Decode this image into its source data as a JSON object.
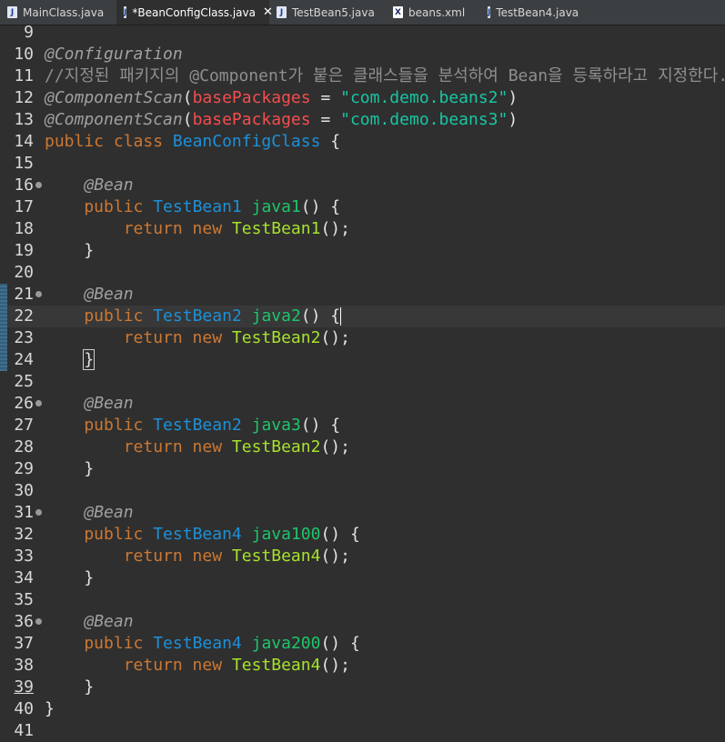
{
  "tabs": [
    {
      "label": "MainClass.java",
      "icon": "java-file-icon",
      "active": false
    },
    {
      "label": "*BeanConfigClass.java",
      "icon": "java-file-icon",
      "active": true,
      "close": "✕"
    },
    {
      "label": "TestBean5.java",
      "icon": "java-file-icon",
      "active": false
    },
    {
      "label": "beans.xml",
      "icon": "xml-file-icon",
      "active": false
    },
    {
      "label": "TestBean4.java",
      "icon": "java-file-icon",
      "active": false
    }
  ],
  "editor": {
    "current_line": 22,
    "lines": [
      {
        "n": "9",
        "tokens": []
      },
      {
        "n": "10",
        "tokens": [
          {
            "t": "@Configuration",
            "c": "ann"
          }
        ]
      },
      {
        "n": "11",
        "tokens": [
          {
            "t": "//지정된 패키지의 @Component가 붙은 클래스들을 분석하여 Bean을 등록하라고 지정한다.",
            "c": "cmt"
          }
        ]
      },
      {
        "n": "12",
        "tokens": [
          {
            "t": "@ComponentScan",
            "c": "ann"
          },
          {
            "t": "(",
            "c": "txt"
          },
          {
            "t": "basePackages",
            "c": "attr"
          },
          {
            "t": " = ",
            "c": "txt"
          },
          {
            "t": "\"com.demo.beans2\"",
            "c": "str"
          },
          {
            "t": ")",
            "c": "txt"
          }
        ]
      },
      {
        "n": "13",
        "tokens": [
          {
            "t": "@ComponentScan",
            "c": "ann"
          },
          {
            "t": "(",
            "c": "txt"
          },
          {
            "t": "basePackages",
            "c": "attr"
          },
          {
            "t": " = ",
            "c": "txt"
          },
          {
            "t": "\"com.demo.beans3\"",
            "c": "str"
          },
          {
            "t": ")",
            "c": "txt"
          }
        ]
      },
      {
        "n": "14",
        "tokens": [
          {
            "t": "public class ",
            "c": "kw"
          },
          {
            "t": "BeanConfigClass",
            "c": "ty"
          },
          {
            "t": " {",
            "c": "txt"
          }
        ]
      },
      {
        "n": "15",
        "tokens": []
      },
      {
        "n": "16",
        "fold": true,
        "tokens": [
          {
            "t": "    ",
            "c": "txt"
          },
          {
            "t": "@Bean",
            "c": "ann"
          }
        ]
      },
      {
        "n": "17",
        "tokens": [
          {
            "t": "    public ",
            "c": "kw"
          },
          {
            "t": "TestBean1",
            "c": "ty"
          },
          {
            "t": " ",
            "c": "txt"
          },
          {
            "t": "java1",
            "c": "mt"
          },
          {
            "t": "() {",
            "c": "txt"
          }
        ]
      },
      {
        "n": "18",
        "tokens": [
          {
            "t": "        return new ",
            "c": "kw"
          },
          {
            "t": "TestBean1",
            "c": "cls"
          },
          {
            "t": "();",
            "c": "txt"
          }
        ]
      },
      {
        "n": "19",
        "tokens": [
          {
            "t": "    }",
            "c": "txt"
          }
        ]
      },
      {
        "n": "20",
        "tokens": []
      },
      {
        "n": "21",
        "fold": true,
        "changed": true,
        "tokens": [
          {
            "t": "    ",
            "c": "txt"
          },
          {
            "t": "@Bean",
            "c": "ann"
          }
        ]
      },
      {
        "n": "22",
        "changed": true,
        "caret": true,
        "tokens": [
          {
            "t": "    public ",
            "c": "kw"
          },
          {
            "t": "TestBean2",
            "c": "ty"
          },
          {
            "t": " ",
            "c": "txt"
          },
          {
            "t": "java2",
            "c": "mt"
          },
          {
            "t": "() {",
            "c": "txt"
          }
        ]
      },
      {
        "n": "23",
        "changed": true,
        "tokens": [
          {
            "t": "        return new ",
            "c": "kw"
          },
          {
            "t": "TestBean2",
            "c": "cls"
          },
          {
            "t": "();",
            "c": "txt"
          }
        ]
      },
      {
        "n": "24",
        "changed": true,
        "tokens": [
          {
            "t": "    ",
            "c": "txt"
          },
          {
            "t": "}",
            "c": "txt bracematch"
          }
        ]
      },
      {
        "n": "25",
        "tokens": []
      },
      {
        "n": "26",
        "fold": true,
        "tokens": [
          {
            "t": "    ",
            "c": "txt"
          },
          {
            "t": "@Bean",
            "c": "ann"
          }
        ]
      },
      {
        "n": "27",
        "tokens": [
          {
            "t": "    public ",
            "c": "kw"
          },
          {
            "t": "TestBean2",
            "c": "ty"
          },
          {
            "t": " ",
            "c": "txt"
          },
          {
            "t": "java3",
            "c": "mt"
          },
          {
            "t": "() {",
            "c": "txt"
          }
        ]
      },
      {
        "n": "28",
        "tokens": [
          {
            "t": "        return new ",
            "c": "kw"
          },
          {
            "t": "TestBean2",
            "c": "cls"
          },
          {
            "t": "();",
            "c": "txt"
          }
        ]
      },
      {
        "n": "29",
        "tokens": [
          {
            "t": "    }",
            "c": "txt"
          }
        ]
      },
      {
        "n": "30",
        "tokens": []
      },
      {
        "n": "31",
        "fold": true,
        "tokens": [
          {
            "t": "    ",
            "c": "txt"
          },
          {
            "t": "@Bean",
            "c": "ann"
          }
        ]
      },
      {
        "n": "32",
        "tokens": [
          {
            "t": "    public ",
            "c": "kw"
          },
          {
            "t": "TestBean4",
            "c": "ty"
          },
          {
            "t": " ",
            "c": "txt"
          },
          {
            "t": "java100",
            "c": "mt"
          },
          {
            "t": "() {",
            "c": "txt"
          }
        ]
      },
      {
        "n": "33",
        "tokens": [
          {
            "t": "        return new ",
            "c": "kw"
          },
          {
            "t": "TestBean4",
            "c": "cls"
          },
          {
            "t": "();",
            "c": "txt"
          }
        ]
      },
      {
        "n": "34",
        "tokens": [
          {
            "t": "    }",
            "c": "txt"
          }
        ]
      },
      {
        "n": "35",
        "tokens": []
      },
      {
        "n": "36",
        "fold": true,
        "tokens": [
          {
            "t": "    ",
            "c": "txt"
          },
          {
            "t": "@Bean",
            "c": "ann"
          }
        ]
      },
      {
        "n": "37",
        "tokens": [
          {
            "t": "    public ",
            "c": "kw"
          },
          {
            "t": "TestBean4",
            "c": "ty"
          },
          {
            "t": " ",
            "c": "txt"
          },
          {
            "t": "java200",
            "c": "mt"
          },
          {
            "t": "() {",
            "c": "txt"
          }
        ]
      },
      {
        "n": "38",
        "tokens": [
          {
            "t": "        return new ",
            "c": "kw"
          },
          {
            "t": "TestBean4",
            "c": "cls"
          },
          {
            "t": "();",
            "c": "txt"
          }
        ]
      },
      {
        "n": "39",
        "underline": true,
        "tokens": [
          {
            "t": "    }",
            "c": "txt"
          }
        ]
      },
      {
        "n": "40",
        "tokens": [
          {
            "t": "}",
            "c": "txt"
          }
        ]
      },
      {
        "n": "41",
        "tokens": []
      }
    ]
  }
}
